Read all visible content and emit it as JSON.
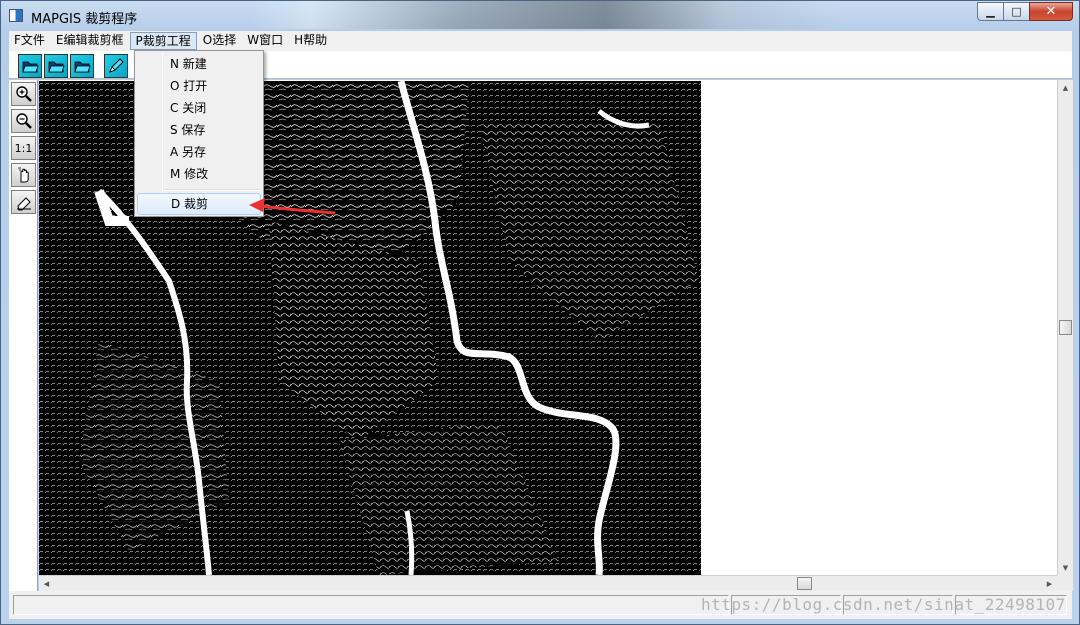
{
  "window": {
    "title": "MAPGIS 裁剪程序"
  },
  "menubar": {
    "items": [
      {
        "label": "F文件"
      },
      {
        "label": "E编辑裁剪框"
      },
      {
        "label": "P裁剪工程",
        "active": true
      },
      {
        "label": "O选择"
      },
      {
        "label": "W窗口"
      },
      {
        "label": "H帮助"
      }
    ]
  },
  "dropdown": {
    "items": [
      {
        "label": "N 新建"
      },
      {
        "label": "O 打开"
      },
      {
        "label": "C 关闭"
      },
      {
        "label": "S 保存"
      },
      {
        "label": "A 另存"
      },
      {
        "label": "M 修改"
      },
      {
        "label": "D 裁剪",
        "highlighted": true
      }
    ]
  },
  "toolbar": {
    "icons": [
      "open-folder-icon",
      "open-folder-icon",
      "open-folder-icon",
      "pen-icon"
    ]
  },
  "left_tools": {
    "zoom_in_icon": "zoom-in-icon",
    "zoom_out_icon": "zoom-out-icon",
    "reset_label": "1:1",
    "pan_icon": "hand-icon",
    "eraser_icon": "eraser-icon"
  },
  "watermark": "https://blog.csdn.net/sinat_22498107",
  "colors": {
    "annotation_arrow": "#e8322e",
    "map_background": "#000000"
  }
}
